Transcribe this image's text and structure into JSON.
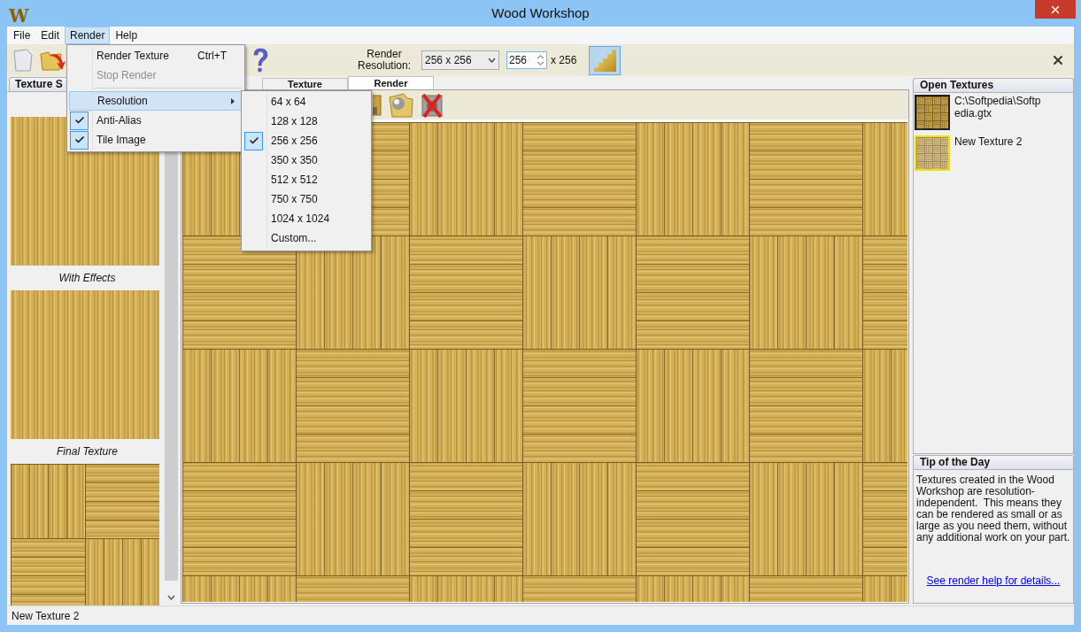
{
  "window": {
    "title": "Wood Workshop",
    "logo": "W"
  },
  "menu_bar": [
    {
      "label": "File",
      "open": false
    },
    {
      "label": "Edit",
      "open": false
    },
    {
      "label": "Render",
      "open": true
    },
    {
      "label": "Help",
      "open": false
    }
  ],
  "render_menu": [
    {
      "kind": "command",
      "label": "Render Texture",
      "shortcut": "Ctrl+T",
      "disabled": false
    },
    {
      "kind": "command",
      "label": "Stop Render",
      "disabled": true
    },
    {
      "kind": "separator"
    },
    {
      "kind": "submenu",
      "label": "Resolution",
      "highlighted": true
    },
    {
      "kind": "toggle",
      "label": "Anti-Alias",
      "checked": true
    },
    {
      "kind": "toggle",
      "label": "Tile Image",
      "checked": true
    }
  ],
  "resolution_submenu": [
    {
      "label": "64 x 64",
      "selected": false
    },
    {
      "label": "128 x 128",
      "selected": false
    },
    {
      "label": "256 x 256",
      "selected": true
    },
    {
      "label": "350 x 350",
      "selected": false
    },
    {
      "label": "512 x 512",
      "selected": false
    },
    {
      "label": "750 x 750",
      "selected": false
    },
    {
      "label": "1024 x 1024",
      "selected": false
    },
    {
      "label": "Custom...",
      "selected": false
    }
  ],
  "toolbar": {
    "resolution_label": "Render Resolution:",
    "resolution_select": "256 x 256",
    "width_value": "256",
    "height_text": "x 256",
    "render_button_active": true
  },
  "left_panel": {
    "tab": "Texture S",
    "sections": [
      {
        "kind": "plain"
      },
      {
        "kind": "plain",
        "label": "With Effects"
      },
      {
        "kind": "parquet",
        "label": "Final Texture"
      }
    ]
  },
  "center_tabs": [
    {
      "label": "Texture",
      "selected": false
    },
    {
      "label": "Render",
      "selected": true
    }
  ],
  "open_textures": {
    "title": "Open Textures",
    "items": [
      {
        "name": "C:\\Softpedia\\Softpedia.gtx",
        "selected": false
      },
      {
        "name": "New Texture 2",
        "selected": true
      }
    ]
  },
  "tip": {
    "title": "Tip of the Day",
    "text": "Textures created in the Wood Workshop are resolution-independent.  This means they can be rendered as small or as large as you need them, without any additional work on your part.",
    "link": "See render help for details..."
  },
  "status_bar": {
    "text": "New Texture 2"
  }
}
